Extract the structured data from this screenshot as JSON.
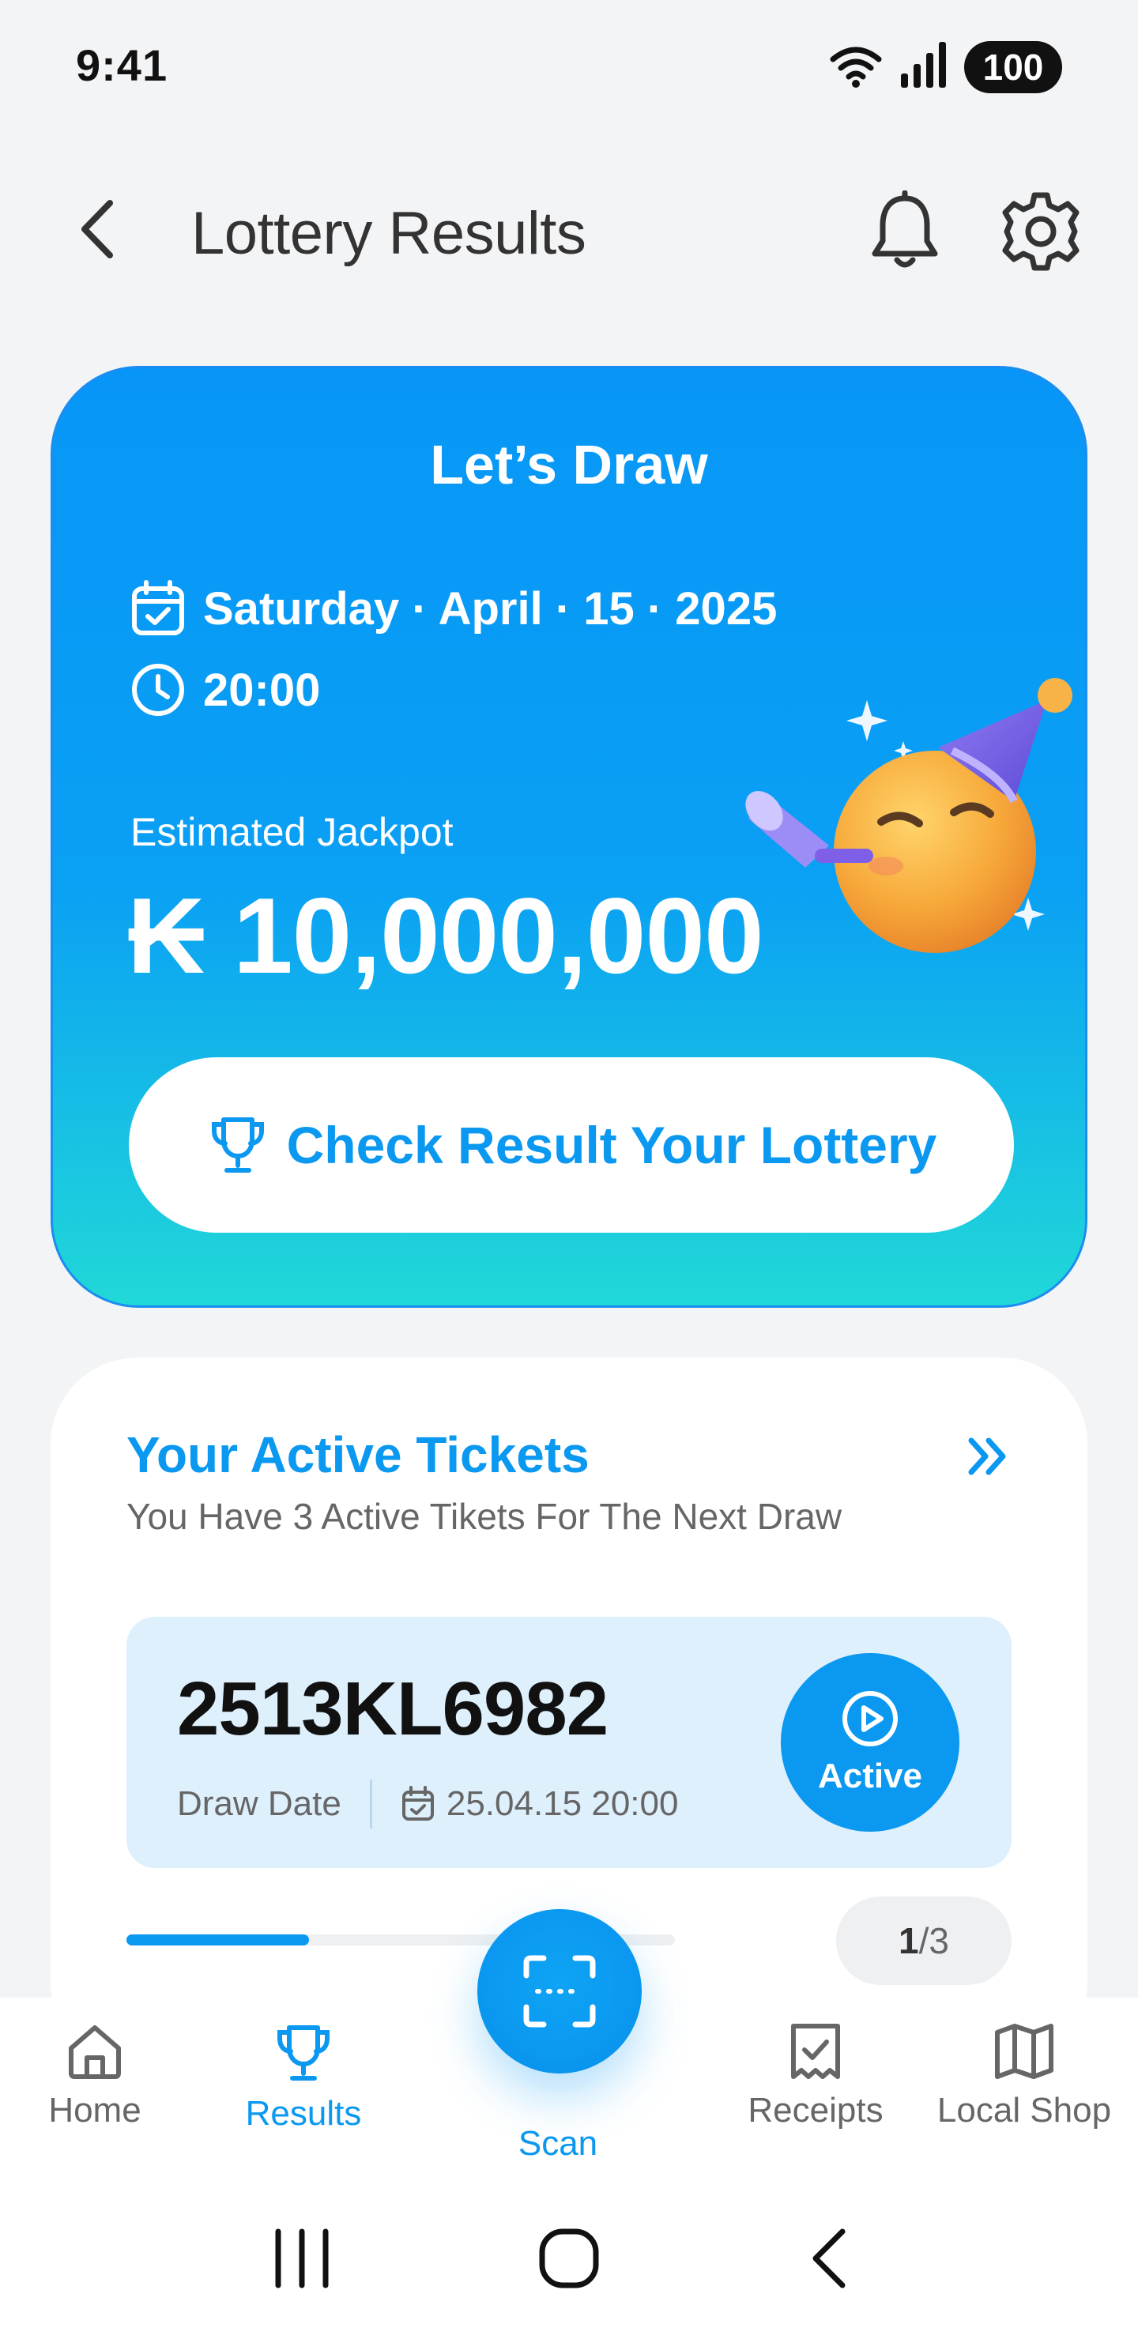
{
  "status_bar": {
    "time": "9:41",
    "battery": "100"
  },
  "header": {
    "title": "Lottery Results"
  },
  "draw_card": {
    "title": "Let’s Draw",
    "date": "Saturday · April · 15 · 2025",
    "time": "20:00",
    "jackpot_label": "Estimated Jackpot",
    "jackpot_value": "₭ 10,000,000",
    "check_button_label": "Check Result Your Lottery"
  },
  "tickets": {
    "title": "Your Active Tickets",
    "subtitle": "You Have 3 Active Tikets For The Next Draw",
    "item": {
      "number": "2513KL6982",
      "draw_date_label": "Draw Date",
      "draw_date_value": "25.04.15 20:00",
      "status_label": "Active"
    },
    "progress_fraction": 0.333,
    "pager": {
      "current": "1",
      "total": "/3"
    }
  },
  "bottom_nav": {
    "items": [
      {
        "label": "Home",
        "icon": "home-icon"
      },
      {
        "label": "Results",
        "icon": "trophy-icon",
        "active": true
      },
      {
        "label": "Scan",
        "icon": "scan-icon"
      },
      {
        "label": "Receipts",
        "icon": "receipt-icon"
      },
      {
        "label": "Local Shop",
        "icon": "map-icon"
      }
    ]
  },
  "colors": {
    "accent": "#0a98f0",
    "background": "#f3f4f6"
  }
}
